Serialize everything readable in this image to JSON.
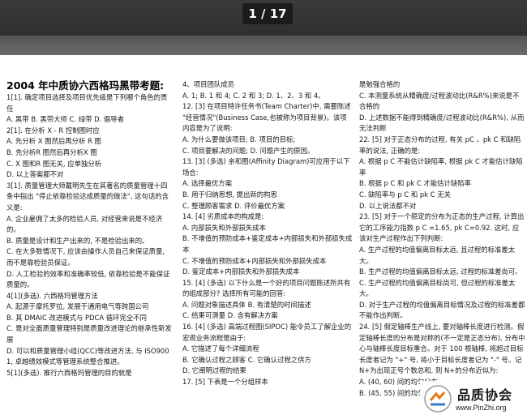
{
  "viewer": {
    "page_indicator": "1 / 17"
  },
  "document": {
    "title": "2004 年中质协六西格玛黑带考题:",
    "col1": [
      "1[1]. 确定项目选择及项目优先级是下列哪个角色的责任",
      "A. 黑带 B. 黑带大师 C. 绿带 D. 倡导者",
      "2[1]. 在分析 X - R 控制图时应",
      "A. 先分析 X 图然后再分析 R 图",
      "B. 先分析R 图然后再分析X 图",
      "C. X 图和R 图无关, 应单独分析",
      "D. 以上答案都不对",
      "3[1]. 质量管理大师戴明先生在其著名的质量管理十四条中指出 \"停止依靠检验达成质量的做法\", 这句话的含义是:",
      "A. 企业雇佣了太多的检验人员, 对经营来说是不经济的。",
      "B. 质量是设计和生产出来的, 不是检验出来的。",
      "C. 在大多数情况下, 应该由操作人员自己来保证质量, 而不是靠检验员保证。",
      "D. 人工检验的效率和准确率较低, 依靠检验是不能保证质量的。",
      "4[1](多选). 六西格玛管理方法",
      "A. 起源于摩托罗拉, 发展于通用电气等跨国公司",
      "B. 其 DMAIC 改进模式与 PDCA 循环完全不同",
      "C. 是对全面质量管理特别是质量改进理论的继承性新发展",
      "D. 可以和质量管理小组(QCC)等改进方法, 与 ISO9001, 卓越绩效模式等管理系统整合推进。",
      "5[1](多选). 推行六西格玛管理的目的就是"
    ],
    "col2": [
      "4、项目团队成员",
      "A. 1; B. 1 和 4; C. 2 和 3; D. 1、2、3 和 4。",
      "12. [3] 在项目特许任务书(Team Charter)中, 需要陈述 \"经营情况\"(Business Case,也被称为项目背景)。该项内容是为了说明:",
      "A. 为什么要做该项目; B. 项目的目标;",
      "C. 项目要解决的问题; D. 问题产生的原因。",
      "13. [3] (多选) 亲和图(Affinity Diagram)可应用于以下场合:",
      "A. 选择最优方案",
      "B. 用于归纳思想, 提出新的构思",
      "C. 整理顾客需求 D. 评价最优方案",
      "14. [4] 劣质成本的构成是:",
      "A. 内部损失和外部损失成本",
      "B. 不增值的预防成本+鉴定成本+内部损失和外部损失成本",
      "C. 不增值的预防成本+内部损失和外部损失成本",
      "D. 鉴定成本+内部损失和外部损失成本",
      "15. [4] (多选) 以下什么是一个好的项目问题陈述所共有的组成部分? 选择所有可能的回答:",
      "A. 问题对象描述具体 B. 有清楚的时间描述",
      "C. 结果可测量 D. 含有解决方案",
      "16. [4] (多选) 高端过程图(SIPOC) 能令员工了解企业的宏观业务流程是由于:",
      "A. 它描述了每个详细流程",
      "B. 它确认过程之顾客 C. 它确认过程之供方",
      "D. 它阐明过程的结果",
      "17. [5] 下表是一个分组样本"
    ],
    "col3": [
      "是勉强合格的",
      "C. 本测量系统从精确度/过程波动比(R&R%)来说是不合格的",
      "D. 上述数据不能得到精确度/过程波动比(R&R%), 从而无法判断",
      "22. [5] 对于正态分布的过程, 有关 pC 、pk C 和缺陷率的说法, 正确的是:",
      "A. 根据 p C 不能估计缺陷率, 根据 pk C 才能估计缺陷率",
      "B. 根据 p C 和 pk C 才能估计缺陷率",
      "C. 缺陷率与 p C 和 pk C 无关",
      "D. 以上说法都不对",
      "23. [5] 对于一个稳定的分布为正态的生产过程, 计算出它的工序能力指数 p C =1.65, pk C=0.92. 这时, 应该对生产过程作出下列判断:",
      "A. 生产过程的均值偏离目标太远, 且过程的标准差太大。",
      "B. 生产过程的均值偏离目标太远, 过程的标准差尚可。",
      "C. 生产过程的均值偏离目标尚可, 但过程的标准差太大。",
      "D. 对于生产过程的均值偏离目标情况及过程的标准差都不能作出判断。",
      "24. [5] 假定轴棒生产线上, 要对轴棒长度进行检测。假定轴棒长度的分布是对称的(不一定是正态分布), 分布中心与轴棒长度目标重合。对于 100 根轴棒, 将超过目标长度者记为 \"+\" 号, 将小于目标长度者记为 \"-\" 号。记 N+为出现正号个数总和, 则 N+的分布近似为:",
      "A. (40, 60) 间的均匀分布。",
      "B. (45, 55) 间的均匀分布。"
    ]
  },
  "watermark": {
    "name": "品质协会",
    "url": "www.PinZhi.org"
  }
}
